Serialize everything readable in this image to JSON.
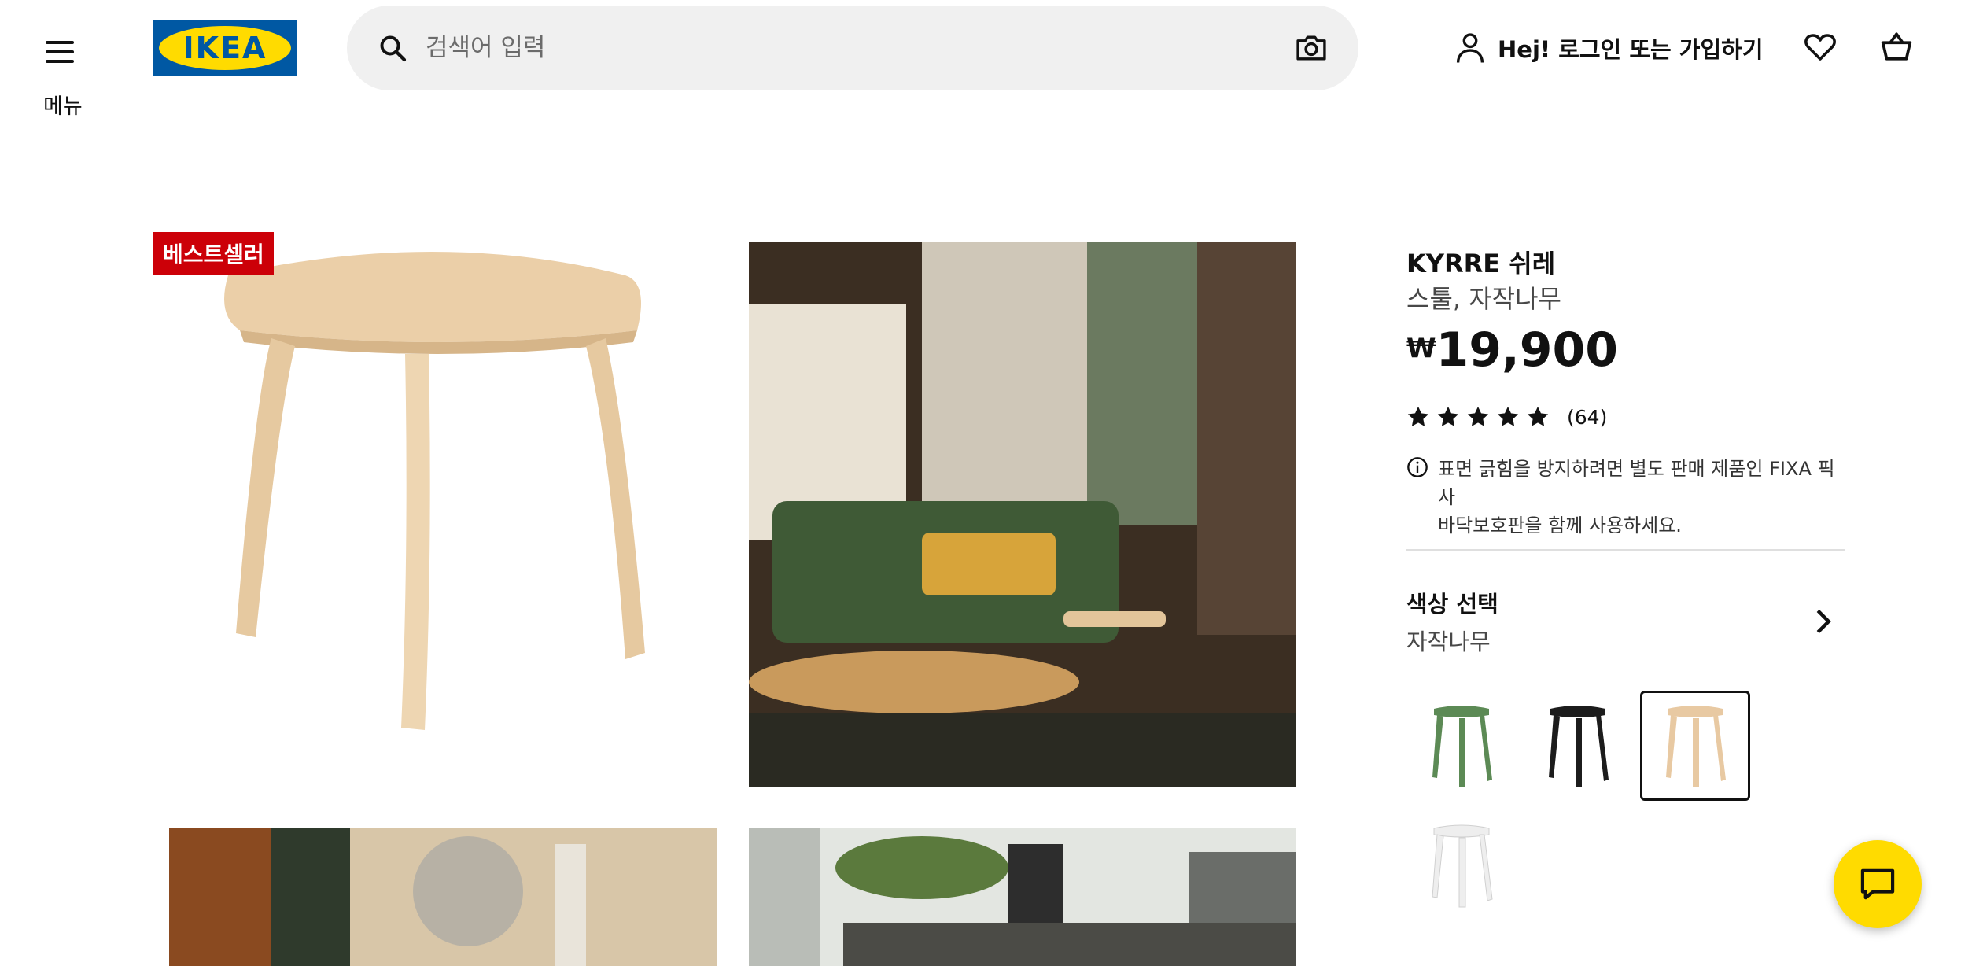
{
  "header": {
    "menu_label": "메뉴",
    "logo_text": "IKEA",
    "search_placeholder": "검색어 입력",
    "login_label": "Hej! 로그인 또는 가입하기"
  },
  "gallery": {
    "badge": "베스트셀러"
  },
  "product": {
    "name": "KYRRE 쉬레",
    "description": "스툴, 자작나무",
    "currency": "₩",
    "price": "19,900",
    "rating_stars": 5,
    "review_count": "(64)",
    "notice_line1": "표면 긁힘을 방지하려면 별도 판매 제품인 FIXA 픽사",
    "notice_line2": "바닥보호판을 함께 사용하세요.",
    "color_title": "색상 선택",
    "color_current": "자작나무"
  },
  "colors": {
    "brand_blue": "#0058a3",
    "brand_yellow": "#ffdb00",
    "badge_red": "#cc0008",
    "swatches": [
      "#5c8a55",
      "#1c1c1c",
      "#e8c9a2",
      "#f4f4f4"
    ]
  }
}
